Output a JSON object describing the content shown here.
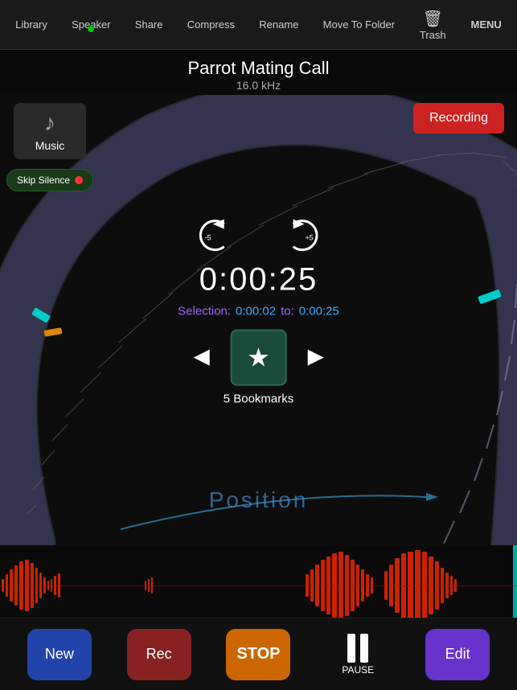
{
  "nav": {
    "items": [
      {
        "label": "Library",
        "id": "library",
        "icon": null,
        "hasDot": false
      },
      {
        "label": "Speaker",
        "id": "speaker",
        "icon": null,
        "hasDot": true
      },
      {
        "label": "Share",
        "id": "share",
        "icon": null,
        "hasDot": false
      },
      {
        "label": "Compress",
        "id": "compress",
        "icon": null,
        "hasDot": false
      },
      {
        "label": "Rename",
        "id": "rename",
        "icon": null,
        "hasDot": false
      },
      {
        "label": "Move To Folder",
        "id": "move-to-folder",
        "icon": null,
        "hasDot": false
      },
      {
        "label": "Trash",
        "id": "trash",
        "icon": "🗑",
        "hasDot": false
      },
      {
        "label": "MENU",
        "id": "menu",
        "icon": null,
        "hasDot": false
      }
    ]
  },
  "title": "Parrot Mating Call",
  "khz": "16.0 kHz",
  "left_panel": {
    "music_label": "Music",
    "skip_silence_label": "Skip Silence"
  },
  "recording_label": "Recording",
  "rewind_label": "-5",
  "forward_label": "+5",
  "time": "0:00:25",
  "selection": {
    "label": "Selection:",
    "start": "0:00:02",
    "to": "to:",
    "end": "0:00:25"
  },
  "bookmarks_label": "5 Bookmarks",
  "position_label": "Position",
  "bottom_controls": {
    "new_label": "New",
    "rec_label": "Rec",
    "stop_label": "STOP",
    "pause_label": "PAUSE",
    "edit_label": "Edit"
  }
}
